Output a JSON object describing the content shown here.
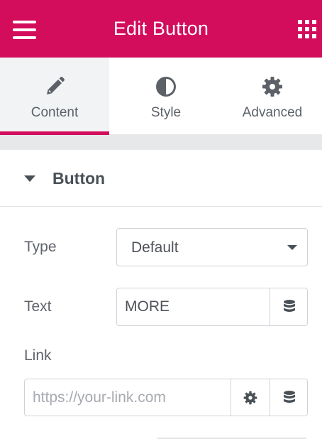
{
  "header": {
    "title": "Edit Button",
    "menu_icon": "hamburger-menu-icon",
    "widgets_icon": "grid-icon",
    "background_color": "#d30c5c"
  },
  "tabs": [
    {
      "label": "Content",
      "icon": "pencil-icon",
      "active": true
    },
    {
      "label": "Style",
      "icon": "half-circle-icon",
      "active": false
    },
    {
      "label": "Advanced",
      "icon": "gear-icon",
      "active": false
    }
  ],
  "section": {
    "title": "Button",
    "expanded": true
  },
  "controls": {
    "type": {
      "label": "Type",
      "value": "Default"
    },
    "text": {
      "label": "Text",
      "value": "MORE",
      "dynamic_icon": "database-icon"
    },
    "link": {
      "label": "Link",
      "value": "",
      "placeholder": "https://your-link.com",
      "options_icon": "gear-icon",
      "dynamic_icon": "database-icon"
    }
  },
  "colors": {
    "accent": "#d30c5c",
    "text": "#4f5359",
    "border": "#cfd3d8"
  }
}
